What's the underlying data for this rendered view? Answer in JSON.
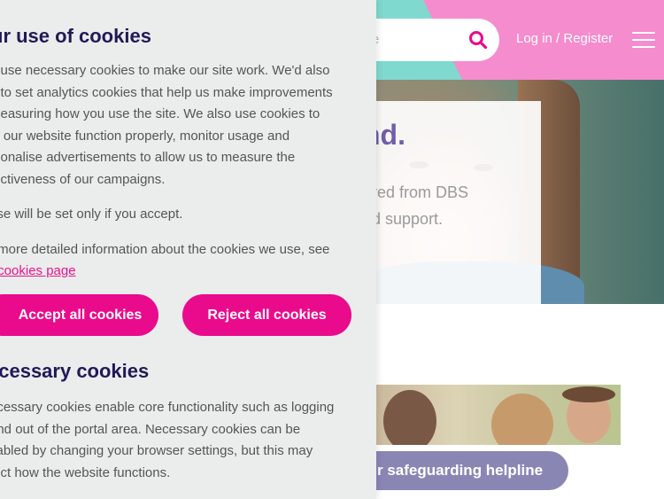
{
  "colors": {
    "brand_pink": "#ea0a8c",
    "header_teal": "#7fd9cf",
    "header_pink": "#f58ccd",
    "title_navy": "#1f1a57",
    "helpline_purple": "#8a86b4"
  },
  "header": {
    "search_placeholder_tail": "e",
    "search_icon": "search-icon",
    "login_label": "Log in / Register",
    "menu_icon": "hamburger-menu-icon"
  },
  "hero": {
    "heading_tail": "nd.",
    "text_lines": [
      "ered from DBS",
      "nd support."
    ]
  },
  "helpline": {
    "label": "r safeguarding helpline"
  },
  "cookie_panel": {
    "title": "ur use of cookies",
    "intro_lines": [
      "e use necessary cookies to make our site work. We'd also",
      "e to set analytics cookies that help us make improvements",
      "measuring how you use the site. We also use cookies to",
      "lp our website function properly, monitor usage and",
      "rsonalise advertisements to allow us to measure the",
      "fectiveness of our campaigns."
    ],
    "consent_note": "ese will be set only if you accept.",
    "more_info_line1": "r more detailed information about the cookies we use, see",
    "more_info_prefix": "r ",
    "cookies_page_link": "cookies page",
    "accept_label": "Accept all cookies",
    "reject_label": "Reject all cookies",
    "necessary_title": "ecessary cookies",
    "necessary_lines": [
      "ecessary cookies enable core functionality such as logging",
      "and out of the portal area. Necessary cookies can be",
      "sabled by changing your browser settings, but this may",
      "fect how the website functions."
    ]
  }
}
